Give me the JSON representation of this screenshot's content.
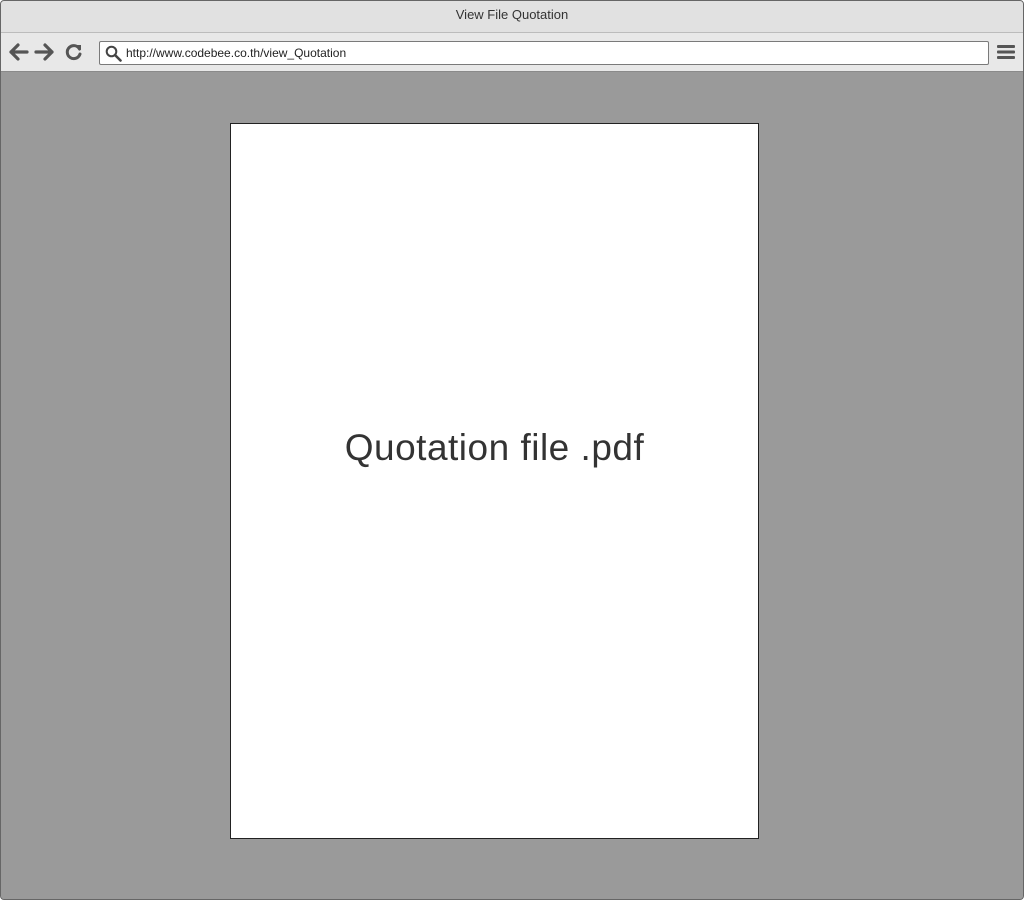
{
  "window": {
    "title": "View File Quotation"
  },
  "toolbar": {
    "back_icon": "arrow-left-icon",
    "forward_icon": "arrow-right-icon",
    "reload_icon": "reload-icon",
    "search_icon": "search-icon",
    "menu_icon": "hamburger-menu-icon",
    "url": "http://www.codebee.co.th/view_Quotation"
  },
  "document": {
    "label": "Quotation file .pdf"
  },
  "colors": {
    "window_background": "#9a9a9a",
    "page_background": "#ffffff",
    "toolbar_background": "#e8e8e8",
    "text": "#333333"
  }
}
